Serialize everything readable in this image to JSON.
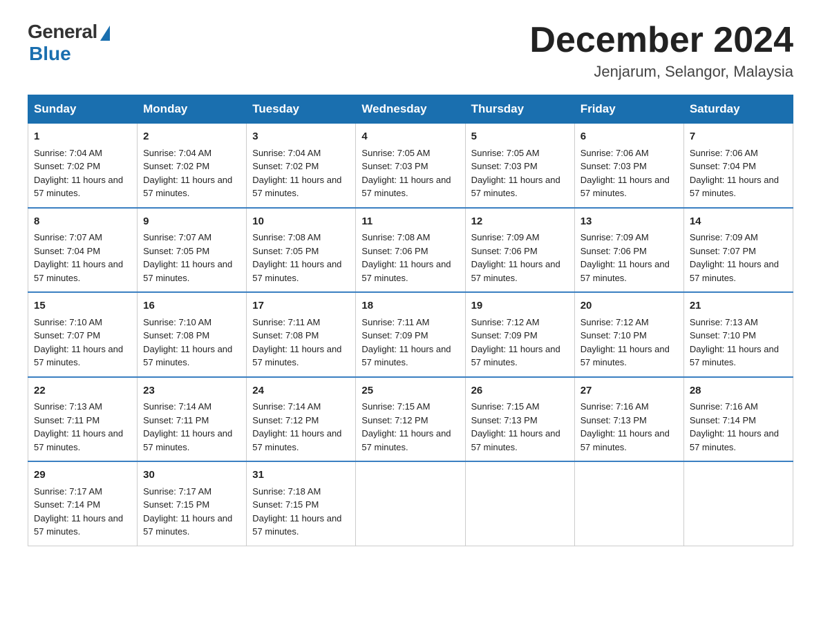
{
  "logo": {
    "general_text": "General",
    "blue_text": "Blue"
  },
  "title": "December 2024",
  "location": "Jenjarum, Selangor, Malaysia",
  "days_of_week": [
    "Sunday",
    "Monday",
    "Tuesday",
    "Wednesday",
    "Thursday",
    "Friday",
    "Saturday"
  ],
  "weeks": [
    [
      {
        "day": "1",
        "sunrise": "7:04 AM",
        "sunset": "7:02 PM",
        "daylight": "11 hours and 57 minutes."
      },
      {
        "day": "2",
        "sunrise": "7:04 AM",
        "sunset": "7:02 PM",
        "daylight": "11 hours and 57 minutes."
      },
      {
        "day": "3",
        "sunrise": "7:04 AM",
        "sunset": "7:02 PM",
        "daylight": "11 hours and 57 minutes."
      },
      {
        "day": "4",
        "sunrise": "7:05 AM",
        "sunset": "7:03 PM",
        "daylight": "11 hours and 57 minutes."
      },
      {
        "day": "5",
        "sunrise": "7:05 AM",
        "sunset": "7:03 PM",
        "daylight": "11 hours and 57 minutes."
      },
      {
        "day": "6",
        "sunrise": "7:06 AM",
        "sunset": "7:03 PM",
        "daylight": "11 hours and 57 minutes."
      },
      {
        "day": "7",
        "sunrise": "7:06 AM",
        "sunset": "7:04 PM",
        "daylight": "11 hours and 57 minutes."
      }
    ],
    [
      {
        "day": "8",
        "sunrise": "7:07 AM",
        "sunset": "7:04 PM",
        "daylight": "11 hours and 57 minutes."
      },
      {
        "day": "9",
        "sunrise": "7:07 AM",
        "sunset": "7:05 PM",
        "daylight": "11 hours and 57 minutes."
      },
      {
        "day": "10",
        "sunrise": "7:08 AM",
        "sunset": "7:05 PM",
        "daylight": "11 hours and 57 minutes."
      },
      {
        "day": "11",
        "sunrise": "7:08 AM",
        "sunset": "7:06 PM",
        "daylight": "11 hours and 57 minutes."
      },
      {
        "day": "12",
        "sunrise": "7:09 AM",
        "sunset": "7:06 PM",
        "daylight": "11 hours and 57 minutes."
      },
      {
        "day": "13",
        "sunrise": "7:09 AM",
        "sunset": "7:06 PM",
        "daylight": "11 hours and 57 minutes."
      },
      {
        "day": "14",
        "sunrise": "7:09 AM",
        "sunset": "7:07 PM",
        "daylight": "11 hours and 57 minutes."
      }
    ],
    [
      {
        "day": "15",
        "sunrise": "7:10 AM",
        "sunset": "7:07 PM",
        "daylight": "11 hours and 57 minutes."
      },
      {
        "day": "16",
        "sunrise": "7:10 AM",
        "sunset": "7:08 PM",
        "daylight": "11 hours and 57 minutes."
      },
      {
        "day": "17",
        "sunrise": "7:11 AM",
        "sunset": "7:08 PM",
        "daylight": "11 hours and 57 minutes."
      },
      {
        "day": "18",
        "sunrise": "7:11 AM",
        "sunset": "7:09 PM",
        "daylight": "11 hours and 57 minutes."
      },
      {
        "day": "19",
        "sunrise": "7:12 AM",
        "sunset": "7:09 PM",
        "daylight": "11 hours and 57 minutes."
      },
      {
        "day": "20",
        "sunrise": "7:12 AM",
        "sunset": "7:10 PM",
        "daylight": "11 hours and 57 minutes."
      },
      {
        "day": "21",
        "sunrise": "7:13 AM",
        "sunset": "7:10 PM",
        "daylight": "11 hours and 57 minutes."
      }
    ],
    [
      {
        "day": "22",
        "sunrise": "7:13 AM",
        "sunset": "7:11 PM",
        "daylight": "11 hours and 57 minutes."
      },
      {
        "day": "23",
        "sunrise": "7:14 AM",
        "sunset": "7:11 PM",
        "daylight": "11 hours and 57 minutes."
      },
      {
        "day": "24",
        "sunrise": "7:14 AM",
        "sunset": "7:12 PM",
        "daylight": "11 hours and 57 minutes."
      },
      {
        "day": "25",
        "sunrise": "7:15 AM",
        "sunset": "7:12 PM",
        "daylight": "11 hours and 57 minutes."
      },
      {
        "day": "26",
        "sunrise": "7:15 AM",
        "sunset": "7:13 PM",
        "daylight": "11 hours and 57 minutes."
      },
      {
        "day": "27",
        "sunrise": "7:16 AM",
        "sunset": "7:13 PM",
        "daylight": "11 hours and 57 minutes."
      },
      {
        "day": "28",
        "sunrise": "7:16 AM",
        "sunset": "7:14 PM",
        "daylight": "11 hours and 57 minutes."
      }
    ],
    [
      {
        "day": "29",
        "sunrise": "7:17 AM",
        "sunset": "7:14 PM",
        "daylight": "11 hours and 57 minutes."
      },
      {
        "day": "30",
        "sunrise": "7:17 AM",
        "sunset": "7:15 PM",
        "daylight": "11 hours and 57 minutes."
      },
      {
        "day": "31",
        "sunrise": "7:18 AM",
        "sunset": "7:15 PM",
        "daylight": "11 hours and 57 minutes."
      },
      null,
      null,
      null,
      null
    ]
  ],
  "labels": {
    "sunrise": "Sunrise:",
    "sunset": "Sunset:",
    "daylight": "Daylight:"
  }
}
